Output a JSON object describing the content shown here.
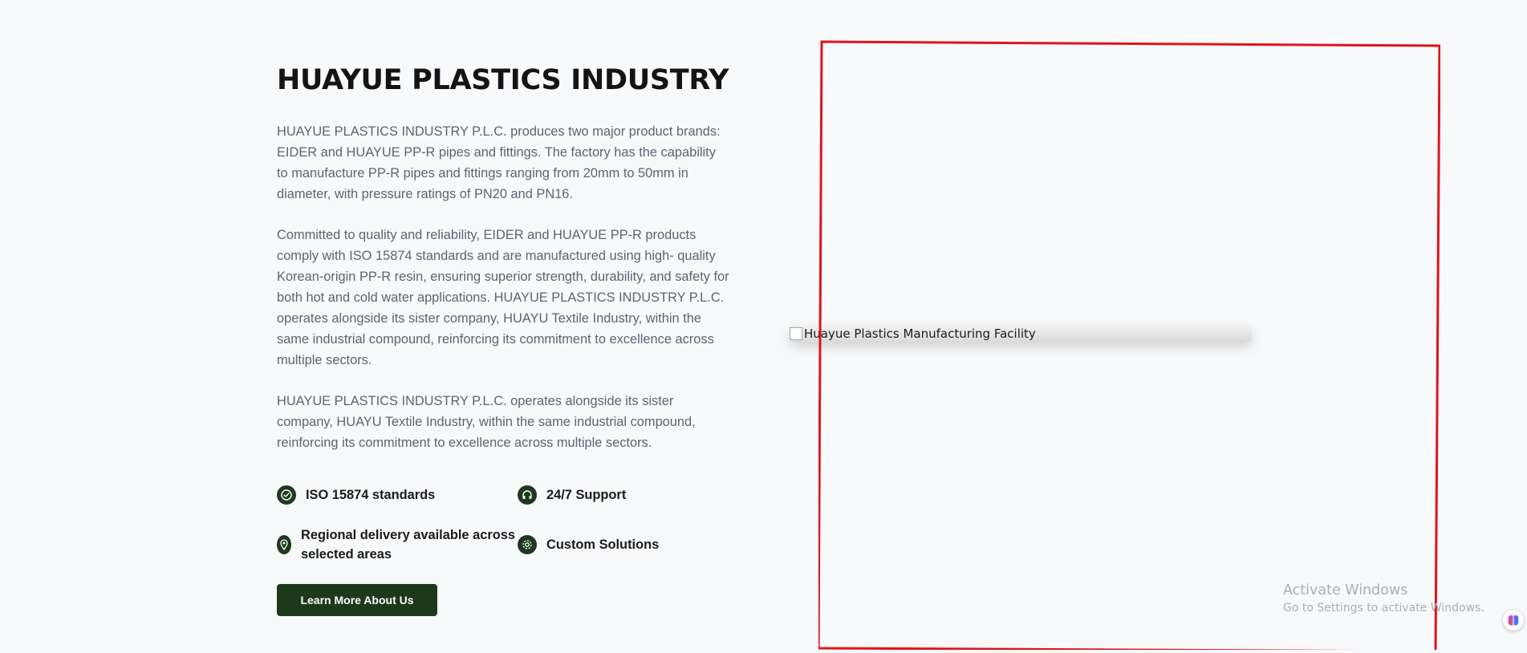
{
  "about": {
    "title": "HUAYUE PLASTICS INDUSTRY",
    "paragraphs": [
      "HUAYUE PLASTICS INDUSTRY P.L.C. produces two major product brands: EIDER and HUAYUE PP-R pipes and fittings. The factory has the capability to manufacture PP-R pipes and fittings ranging from 20mm to 50mm in diameter, with pressure ratings of PN20 and PN16.",
      "Committed to quality and reliability, EIDER and HUAYUE PP-R products comply with ISO 15874 standards and are manufactured using high- quality Korean-origin PP-R resin, ensuring superior strength, durability, and safety for both hot and cold water applications. HUAYUE PLASTICS INDUSTRY P.L.C. operates alongside its sister company, HUAYU Textile Industry, within the same industrial compound, reinforcing its commitment to excellence across multiple sectors.",
      "HUAYUE PLASTICS INDUSTRY P.L.C. operates alongside its sister company, HUAYU Textile Industry, within the same industrial compound, reinforcing its commitment to excellence across multiple sectors."
    ],
    "features": [
      {
        "label": "ISO 15874 standards",
        "icon": "check-circle-icon"
      },
      {
        "label": "24/7 Support",
        "icon": "headphones-icon"
      },
      {
        "label": "Regional delivery available across selected areas",
        "icon": "map-pin-icon"
      },
      {
        "label": "Custom Solutions",
        "icon": "gear-icon"
      }
    ],
    "button_label": "Learn More About Us"
  },
  "image": {
    "alt": "Huayue Plastics Manufacturing Facility"
  },
  "windows_notice": {
    "title": "Activate Windows",
    "subtitle": "Go to Settings to activate Windows."
  },
  "colors": {
    "accent": "#1c3a1a",
    "annotation": "#e0141a",
    "background": "#f8f9fb"
  }
}
